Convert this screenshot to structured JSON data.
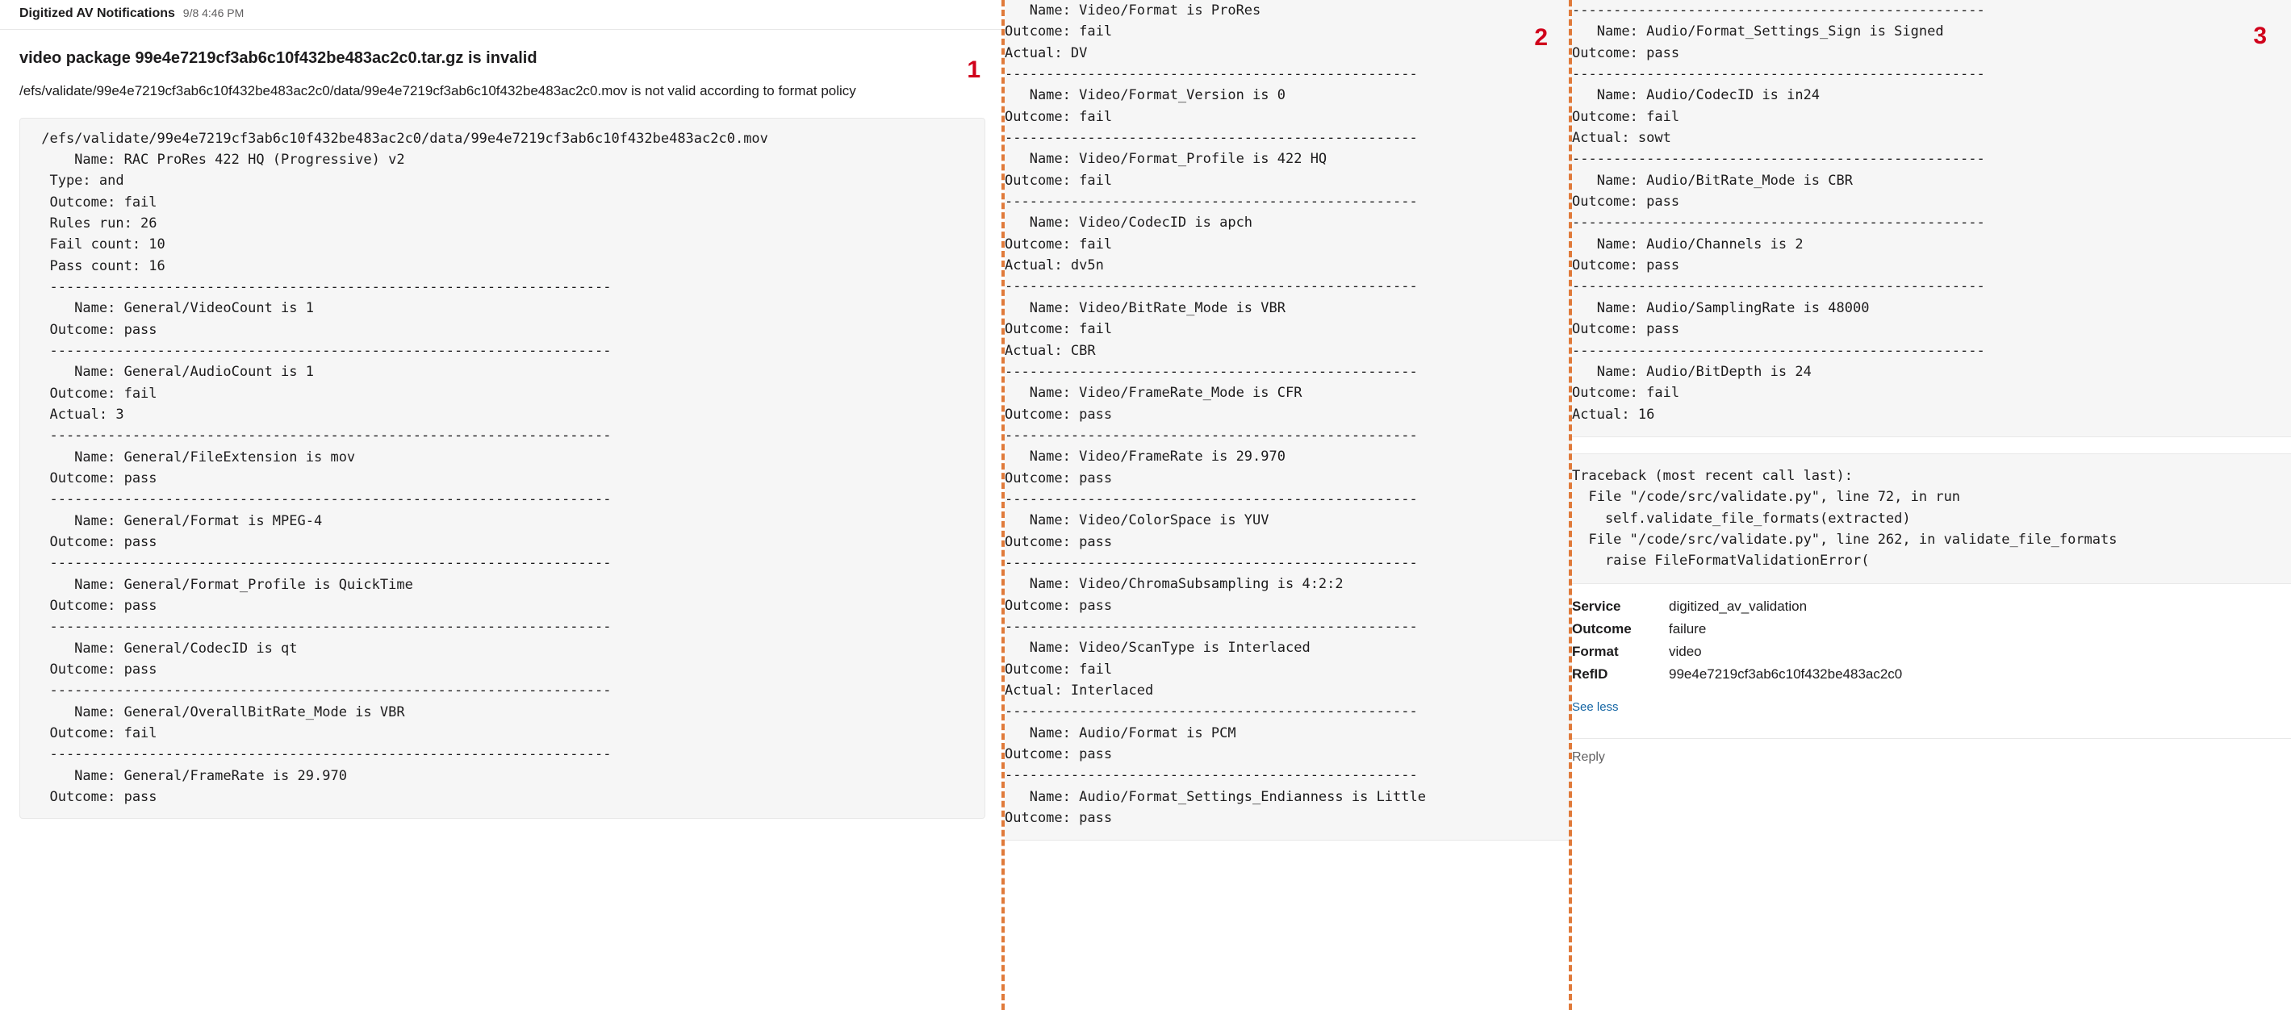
{
  "header": {
    "sender": "Digitized AV Notifications",
    "timestamp": "9/8 4:46 PM"
  },
  "message": {
    "title": "video package 99e4e7219cf3ab6c10f432be483ac2c0.tar.gz is invalid",
    "subtitle": "/efs/validate/99e4e7219cf3ab6c10f432be483ac2c0/data/99e4e7219cf3ab6c10f432be483ac2c0.mov is not valid according to format policy"
  },
  "panel_numbers": {
    "p1": "1",
    "p2": "2",
    "p3": "3"
  },
  "code1": " /efs/validate/99e4e7219cf3ab6c10f432be483ac2c0/data/99e4e7219cf3ab6c10f432be483ac2c0.mov\n     Name: RAC ProRes 422 HQ (Progressive) v2\n  Type: and\n  Outcome: fail\n  Rules run: 26\n  Fail count: 10\n  Pass count: 16\n  --------------------------------------------------------------------\n     Name: General/VideoCount is 1\n  Outcome: pass\n  --------------------------------------------------------------------\n     Name: General/AudioCount is 1\n  Outcome: fail\n  Actual: 3\n  --------------------------------------------------------------------\n     Name: General/FileExtension is mov\n  Outcome: pass\n  --------------------------------------------------------------------\n     Name: General/Format is MPEG-4\n  Outcome: pass\n  --------------------------------------------------------------------\n     Name: General/Format_Profile is QuickTime\n  Outcome: pass\n  --------------------------------------------------------------------\n     Name: General/CodecID is qt\n  Outcome: pass\n  --------------------------------------------------------------------\n     Name: General/OverallBitRate_Mode is VBR\n  Outcome: fail\n  --------------------------------------------------------------------\n     Name: General/FrameRate is 29.970\n  Outcome: pass",
  "code2": "   Name: Video/Format is ProRes\nOutcome: fail\nActual: DV\n--------------------------------------------------\n   Name: Video/Format_Version is 0\nOutcome: fail\n--------------------------------------------------\n   Name: Video/Format_Profile is 422 HQ\nOutcome: fail\n--------------------------------------------------\n   Name: Video/CodecID is apch\nOutcome: fail\nActual: dv5n\n--------------------------------------------------\n   Name: Video/BitRate_Mode is VBR\nOutcome: fail\nActual: CBR\n--------------------------------------------------\n   Name: Video/FrameRate_Mode is CFR\nOutcome: pass\n--------------------------------------------------\n   Name: Video/FrameRate is 29.970\nOutcome: pass\n--------------------------------------------------\n   Name: Video/ColorSpace is YUV\nOutcome: pass\n--------------------------------------------------\n   Name: Video/ChromaSubsampling is 4:2:2\nOutcome: pass\n--------------------------------------------------\n   Name: Video/ScanType is Interlaced\nOutcome: fail\nActual: Interlaced\n--------------------------------------------------\n   Name: Audio/Format is PCM\nOutcome: pass\n--------------------------------------------------\n   Name: Audio/Format_Settings_Endianness is Little\nOutcome: pass",
  "code3": "--------------------------------------------------\n   Name: Audio/Format_Settings_Sign is Signed\nOutcome: pass\n--------------------------------------------------\n   Name: Audio/CodecID is in24\nOutcome: fail\nActual: sowt\n--------------------------------------------------\n   Name: Audio/BitRate_Mode is CBR\nOutcome: pass\n--------------------------------------------------\n   Name: Audio/Channels is 2\nOutcome: pass\n--------------------------------------------------\n   Name: Audio/SamplingRate is 48000\nOutcome: pass\n--------------------------------------------------\n   Name: Audio/BitDepth is 24\nOutcome: fail\nActual: 16",
  "traceback": "Traceback (most recent call last):\n  File \"/code/src/validate.py\", line 72, in run\n    self.validate_file_formats(extracted)\n  File \"/code/src/validate.py\", line 262, in validate_file_formats\n    raise FileFormatValidationError(",
  "meta": {
    "service_key": "Service",
    "service_val": "digitized_av_validation",
    "outcome_key": "Outcome",
    "outcome_val": "failure",
    "format_key": "Format",
    "format_val": "video",
    "refid_key": "RefID",
    "refid_val": "99e4e7219cf3ab6c10f432be483ac2c0"
  },
  "see_less": "See less",
  "reply": "Reply"
}
